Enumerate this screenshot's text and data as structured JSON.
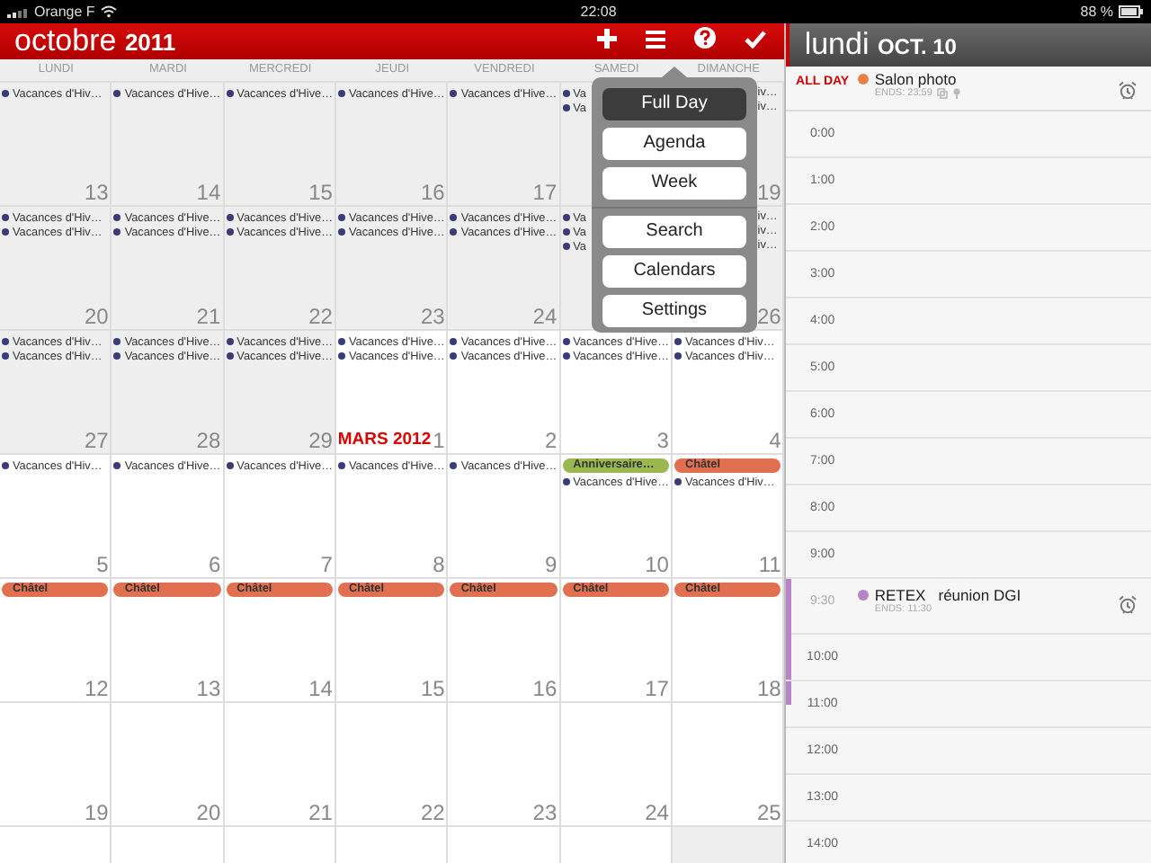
{
  "status_bar": {
    "carrier": "Orange F",
    "time": "22:08",
    "battery": "88 %"
  },
  "month_header": {
    "title": "octobre **2011**"
  },
  "weekdays": [
    "LUNDI",
    "MARDI",
    "MERCREDI",
    "JEUDI",
    "VENDREDI",
    "SAMEDI",
    "DIMANCHE"
  ],
  "weeks": [
    {
      "days": [
        {
          "day": "13",
          "muted": true,
          "events": [
            {
              "kind": "dot",
              "text": "Vacances d'Hiv…",
              "color": "#3b3b78"
            }
          ]
        },
        {
          "day": "14",
          "muted": true,
          "events": [
            {
              "kind": "dot",
              "text": "Vacances d'Hive…",
              "color": "#3b3b78"
            }
          ]
        },
        {
          "day": "15",
          "muted": true,
          "events": [
            {
              "kind": "dot",
              "text": "Vacances d'Hive…",
              "color": "#3b3b78"
            }
          ]
        },
        {
          "day": "16",
          "muted": true,
          "events": [
            {
              "kind": "dot",
              "text": "Vacances d'Hive…",
              "color": "#3b3b78"
            }
          ]
        },
        {
          "day": "17",
          "muted": true,
          "events": [
            {
              "kind": "dot",
              "text": "Vacances d'Hive…",
              "color": "#3b3b78"
            }
          ]
        },
        {
          "muted": true,
          "events": [
            {
              "kind": "dot",
              "text": "Va",
              "color": "#3b3b78"
            },
            {
              "kind": "dot",
              "text": "Va",
              "color": "#3b3b78"
            }
          ]
        },
        {
          "day": "19",
          "muted": true,
          "events": [
            {
              "kind": "tail",
              "text": "iv…"
            },
            {
              "kind": "tail",
              "text": "iv…"
            }
          ]
        }
      ]
    },
    {
      "days": [
        {
          "day": "20",
          "muted": true,
          "events": [
            {
              "kind": "dot",
              "text": "Vacances d'Hiv…",
              "color": "#3b3b78"
            },
            {
              "kind": "dot",
              "text": "Vacances d'Hiv…",
              "color": "#3b3b78"
            }
          ]
        },
        {
          "day": "21",
          "muted": true,
          "events": [
            {
              "kind": "dot",
              "text": "Vacances d'Hive…",
              "color": "#3b3b78"
            },
            {
              "kind": "dot",
              "text": "Vacances d'Hive…",
              "color": "#3b3b78"
            }
          ]
        },
        {
          "day": "22",
          "muted": true,
          "events": [
            {
              "kind": "dot",
              "text": "Vacances d'Hive…",
              "color": "#3b3b78"
            },
            {
              "kind": "dot",
              "text": "Vacances d'Hive…",
              "color": "#3b3b78"
            }
          ]
        },
        {
          "day": "23",
          "muted": true,
          "events": [
            {
              "kind": "dot",
              "text": "Vacances d'Hive…",
              "color": "#3b3b78"
            },
            {
              "kind": "dot",
              "text": "Vacances d'Hive…",
              "color": "#3b3b78"
            }
          ]
        },
        {
          "day": "24",
          "muted": true,
          "events": [
            {
              "kind": "dot",
              "text": "Vacances d'Hive…",
              "color": "#3b3b78"
            },
            {
              "kind": "dot",
              "text": "Vacances d'Hive…",
              "color": "#3b3b78"
            }
          ]
        },
        {
          "muted": true,
          "events": [
            {
              "kind": "dot",
              "text": "Va",
              "color": "#3b3b78"
            },
            {
              "kind": "dot",
              "text": "Va",
              "color": "#3b3b78"
            },
            {
              "kind": "dot",
              "text": "Va",
              "color": "#3b3b78"
            }
          ]
        },
        {
          "day": "26",
          "muted": true,
          "events": [
            {
              "kind": "tail",
              "text": "iv…"
            },
            {
              "kind": "tail",
              "text": "iv…"
            },
            {
              "kind": "tail",
              "text": "iv…"
            }
          ]
        }
      ]
    },
    {
      "days": [
        {
          "day": "27",
          "muted": true,
          "events": [
            {
              "kind": "dot",
              "text": "Vacances d'Hiv…",
              "color": "#3b3b78"
            },
            {
              "kind": "dot",
              "text": "Vacances d'Hiv…",
              "color": "#3b3b78"
            }
          ]
        },
        {
          "day": "28",
          "muted": true,
          "events": [
            {
              "kind": "dot",
              "text": "Vacances d'Hive…",
              "color": "#3b3b78"
            },
            {
              "kind": "dot",
              "text": "Vacances d'Hive…",
              "color": "#3b3b78"
            }
          ]
        },
        {
          "day": "29",
          "muted": true,
          "events": [
            {
              "kind": "dot",
              "text": "Vacances d'Hive…",
              "color": "#3b3b78"
            },
            {
              "kind": "dot",
              "text": "Vacances d'Hive…",
              "color": "#3b3b78"
            }
          ]
        },
        {
          "day": "1",
          "month_label": "MARS 2012",
          "muted": false,
          "events": [
            {
              "kind": "dot",
              "text": "Vacances d'Hive…",
              "color": "#3b3b78"
            },
            {
              "kind": "dot",
              "text": "Vacances d'Hive…",
              "color": "#3b3b78"
            }
          ]
        },
        {
          "day": "2",
          "muted": false,
          "events": [
            {
              "kind": "dot",
              "text": "Vacances d'Hive…",
              "color": "#3b3b78"
            },
            {
              "kind": "dot",
              "text": "Vacances d'Hive…",
              "color": "#3b3b78"
            }
          ]
        },
        {
          "day": "3",
          "muted": false,
          "events": [
            {
              "kind": "dot",
              "text": "Vacances d'Hive…",
              "color": "#3b3b78"
            },
            {
              "kind": "dot",
              "text": "Vacances d'Hive…",
              "color": "#3b3b78"
            }
          ]
        },
        {
          "day": "4",
          "muted": false,
          "events": [
            {
              "kind": "dot",
              "text": "Vacances d'Hiv…",
              "color": "#3b3b78"
            },
            {
              "kind": "dot",
              "text": "Vacances d'Hiv…",
              "color": "#3b3b78"
            }
          ]
        }
      ]
    },
    {
      "days": [
        {
          "day": "5",
          "muted": false,
          "events": [
            {
              "kind": "dot",
              "text": "Vacances d'Hiv…",
              "color": "#3b3b78"
            }
          ]
        },
        {
          "day": "6",
          "muted": false,
          "events": [
            {
              "kind": "dot",
              "text": "Vacances d'Hive…",
              "color": "#3b3b78"
            }
          ]
        },
        {
          "day": "7",
          "muted": false,
          "events": [
            {
              "kind": "dot",
              "text": "Vacances d'Hive…",
              "color": "#3b3b78"
            }
          ]
        },
        {
          "day": "8",
          "muted": false,
          "events": [
            {
              "kind": "dot",
              "text": "Vacances d'Hive…",
              "color": "#3b3b78"
            }
          ]
        },
        {
          "day": "9",
          "muted": false,
          "events": [
            {
              "kind": "dot",
              "text": "Vacances d'Hive…",
              "color": "#3b3b78"
            }
          ]
        },
        {
          "day": "10",
          "muted": false,
          "events": [
            {
              "kind": "bar",
              "text": "Anniversaire…",
              "color": "#9bb850"
            },
            {
              "kind": "dot",
              "text": "Vacances d'Hive…",
              "color": "#3b3b78"
            }
          ]
        },
        {
          "day": "11",
          "muted": false,
          "events": [
            {
              "kind": "bar",
              "text": "Châtel",
              "color": "#e07050"
            },
            {
              "kind": "dot",
              "text": "Vacances d'Hiv…",
              "color": "#3b3b78"
            }
          ]
        }
      ]
    },
    {
      "days": [
        {
          "day": "12",
          "muted": false,
          "events": [
            {
              "kind": "bar",
              "text": "Châtel",
              "color": "#e07050"
            }
          ]
        },
        {
          "day": "13",
          "muted": false,
          "events": [
            {
              "kind": "bar",
              "text": "Châtel",
              "color": "#e07050"
            }
          ]
        },
        {
          "day": "14",
          "muted": false,
          "events": [
            {
              "kind": "bar",
              "text": "Châtel",
              "color": "#e07050"
            }
          ]
        },
        {
          "day": "15",
          "muted": false,
          "events": [
            {
              "kind": "bar",
              "text": "Châtel",
              "color": "#e07050"
            }
          ]
        },
        {
          "day": "16",
          "muted": false,
          "events": [
            {
              "kind": "bar",
              "text": "Châtel",
              "color": "#e07050"
            }
          ]
        },
        {
          "day": "17",
          "muted": false,
          "events": [
            {
              "kind": "bar",
              "text": "Châtel",
              "color": "#e07050"
            }
          ]
        },
        {
          "day": "18",
          "muted": false,
          "events": [
            {
              "kind": "bar",
              "text": "Châtel",
              "color": "#e07050"
            }
          ]
        }
      ]
    },
    {
      "days": [
        {
          "day": "19",
          "muted": false
        },
        {
          "day": "20",
          "muted": false
        },
        {
          "day": "21",
          "muted": false
        },
        {
          "day": "22",
          "muted": false
        },
        {
          "day": "23",
          "muted": false
        },
        {
          "day": "24",
          "muted": false
        },
        {
          "day": "25",
          "muted": false
        }
      ]
    },
    {
      "days": [
        {
          "muted": false
        },
        {
          "muted": false
        },
        {
          "muted": false
        },
        {
          "muted": false
        },
        {
          "muted": false
        },
        {
          "muted": false
        },
        {
          "muted": true
        }
      ]
    }
  ],
  "view_menu": {
    "groups": [
      [
        {
          "label": "Full Day",
          "selected": true
        },
        {
          "label": "Agenda",
          "selected": false
        },
        {
          "label": "Week",
          "selected": false
        }
      ],
      [
        {
          "label": "Search",
          "selected": false
        },
        {
          "label": "Calendars",
          "selected": false
        },
        {
          "label": "Settings",
          "selected": false
        }
      ]
    ]
  },
  "day_panel": {
    "title": "lundi **OCT. 10**",
    "all_day_label": "ALL DAY",
    "all_day_events": [
      {
        "title": "Salon photo",
        "ends": "ENDS: 23:59",
        "color": "#e8804a",
        "alarm": true
      }
    ],
    "slots": [
      {
        "kind": "hour",
        "time": "0:00"
      },
      {
        "kind": "hour",
        "time": "1:00"
      },
      {
        "kind": "hour",
        "time": "2:00"
      },
      {
        "kind": "hour",
        "time": "3:00"
      },
      {
        "kind": "hour",
        "time": "4:00"
      },
      {
        "kind": "hour",
        "time": "5:00"
      },
      {
        "kind": "hour",
        "time": "6:00"
      },
      {
        "kind": "hour",
        "time": "7:00"
      },
      {
        "kind": "hour",
        "time": "8:00"
      },
      {
        "kind": "hour",
        "time": "9:00"
      },
      {
        "kind": "event",
        "time": "9:30",
        "title": "RETEX   réunion DGI",
        "ends": "ENDS: 11:30",
        "color": "#b784c8",
        "alarm": true
      },
      {
        "kind": "hour",
        "time": "10:00"
      },
      {
        "kind": "hour",
        "time": "11:00"
      },
      {
        "kind": "hour",
        "time": "12:00"
      },
      {
        "kind": "hour",
        "time": "13:00"
      },
      {
        "kind": "hour",
        "time": "14:00"
      }
    ]
  }
}
